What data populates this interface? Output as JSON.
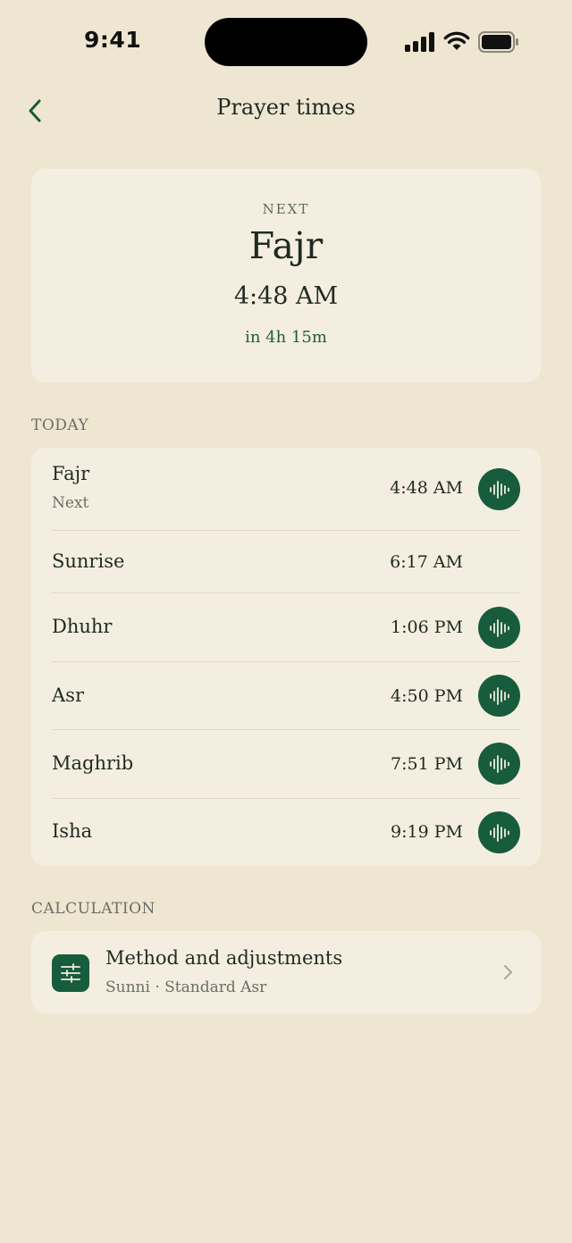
{
  "status_bar": {
    "time": "9:41"
  },
  "nav": {
    "title": "Prayer times"
  },
  "next_prayer": {
    "label": "NEXT",
    "name": "Fajr",
    "time": "4:48 AM",
    "countdown": "in 4h 15m"
  },
  "today": {
    "section_label": "TODAY",
    "prayers": [
      {
        "name": "Fajr",
        "sub": "Next",
        "time": "4:48 AM",
        "has_audio": true
      },
      {
        "name": "Sunrise",
        "sub": "",
        "time": "6:17 AM",
        "has_audio": false
      },
      {
        "name": "Dhuhr",
        "sub": "",
        "time": "1:06 PM",
        "has_audio": true
      },
      {
        "name": "Asr",
        "sub": "",
        "time": "4:50 PM",
        "has_audio": true
      },
      {
        "name": "Maghrib",
        "sub": "",
        "time": "7:51 PM",
        "has_audio": true
      },
      {
        "name": "Isha",
        "sub": "",
        "time": "9:19 PM",
        "has_audio": true
      }
    ]
  },
  "calculation": {
    "section_label": "CALCULATION",
    "title": "Method and adjustments",
    "subtitle": "Sunni · Standard Asr",
    "icon": "sliders-icon"
  },
  "colors": {
    "background": "#EFE6D2",
    "card": "#F4EEE0",
    "accent": "#175C3C",
    "text": "#1F2A21",
    "muted": "#6A6E66"
  },
  "icons": {
    "back": "chevron-left-icon",
    "audio": "sound-wave-icon",
    "disclosure": "chevron-right-icon"
  }
}
